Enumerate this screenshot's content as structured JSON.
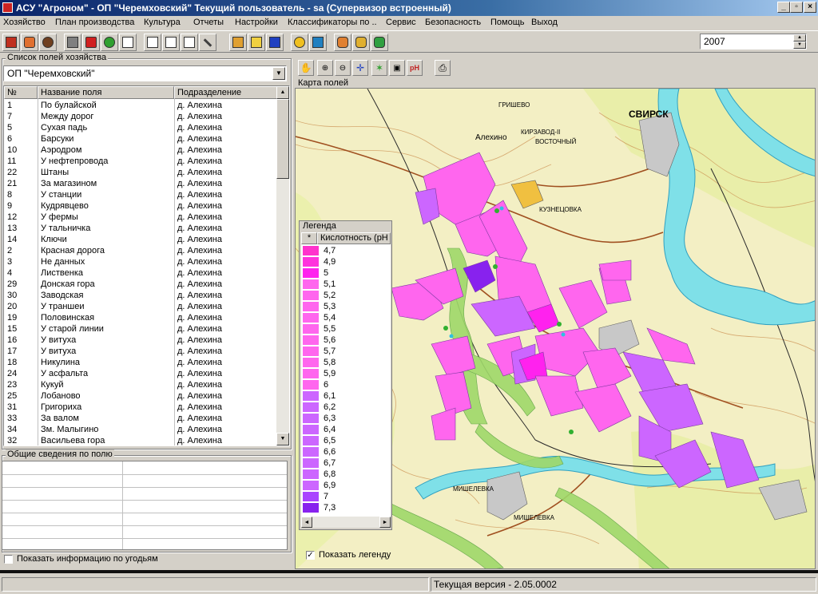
{
  "window": {
    "title": "АСУ \"Агроном\" - ОП \"Черемховский\" Текущий пользователь - sa (Супервизор встроенный)"
  },
  "menu": [
    "Хозяйство",
    "План производства",
    "Культура",
    "Отчеты",
    "Настройки",
    "Классификаторы по ..",
    "Сервис",
    "Безопасность",
    "Помощь",
    "Выход"
  ],
  "toolbar": {
    "year": "2007"
  },
  "fields_panel": {
    "title": "Список полей хозяйства",
    "farm_select": "ОП \"Черемховский\"",
    "columns": [
      "№",
      "Название поля",
      "Подразделение"
    ],
    "rows": [
      [
        "1",
        "По булайской",
        "д. Алехина"
      ],
      [
        "7",
        "Между дорог",
        "д. Алехина"
      ],
      [
        "5",
        "Сухая падь",
        "д. Алехина"
      ],
      [
        "6",
        "Барсуки",
        "д. Алехина"
      ],
      [
        "10",
        "Аэродром",
        "д. Алехина"
      ],
      [
        "11",
        "У нефтепровода",
        "д. Алехина"
      ],
      [
        "22",
        "Штаны",
        "д. Алехина"
      ],
      [
        "21",
        "За магазином",
        "д. Алехина"
      ],
      [
        "8",
        "У станции",
        "д. Алехина"
      ],
      [
        "9",
        "Кудрявцево",
        "д. Алехина"
      ],
      [
        "12",
        "У фермы",
        "д. Алехина"
      ],
      [
        "13",
        "У тальничка",
        "д. Алехина"
      ],
      [
        "14",
        "Ключи",
        "д. Алехина"
      ],
      [
        "2",
        "Красная дорога",
        "д. Алехина"
      ],
      [
        "3",
        "Не данных",
        "д. Алехина"
      ],
      [
        "4",
        "Лиственка",
        "д. Алехина"
      ],
      [
        "29",
        "Донская гора",
        "д. Алехина"
      ],
      [
        "30",
        "Заводская",
        "д. Алехина"
      ],
      [
        "20",
        "У траншеи",
        "д. Алехина"
      ],
      [
        "19",
        "Половинская",
        "д. Алехина"
      ],
      [
        "15",
        "У старой линии",
        "д. Алехина"
      ],
      [
        "16",
        "У витуха",
        "д. Алехина"
      ],
      [
        "17",
        "У витуха",
        "д. Алехина"
      ],
      [
        "18",
        "Никулина",
        "д. Алехина"
      ],
      [
        "24",
        "У асфальта",
        "д. Алехина"
      ],
      [
        "23",
        "Кукуй",
        "д. Алехина"
      ],
      [
        "25",
        "Лобаново",
        "д. Алехина"
      ],
      [
        "31",
        "Григориха",
        "д. Алехина"
      ],
      [
        "33",
        "За валом",
        "д. Алехина"
      ],
      [
        "34",
        "Зм. Малыгино",
        "д. Алехина"
      ],
      [
        "32",
        "Васильева гора",
        "д. Алехина"
      ]
    ]
  },
  "info_panel": {
    "title": "Общие сведения по полю",
    "checkbox_label": "Показать информацию по угодьям"
  },
  "map_panel": {
    "title": "Карта полей",
    "place_labels": [
      "СВИРСК",
      "Алехино",
      "ГРИШЕВО",
      "КИРЗАВОД-II",
      "ВОСТОЧНЫЙ",
      "КУЗНЕЦОВКА",
      "МИШЕЛЕВКА",
      "МИШЕЛЕВКА"
    ],
    "show_legend_label": "Показать легенду"
  },
  "legend": {
    "title": "Легенда",
    "col_marker": "*",
    "col_header": "Кислотность (pH",
    "items": [
      {
        "value": "4,7",
        "color": "#ff33cc"
      },
      {
        "value": "4,9",
        "color": "#ff33dd"
      },
      {
        "value": "5",
        "color": "#ff22ee"
      },
      {
        "value": "5,1",
        "color": "#ff66ee"
      },
      {
        "value": "5,2",
        "color": "#ff66ee"
      },
      {
        "value": "5,3",
        "color": "#ff66ee"
      },
      {
        "value": "5,4",
        "color": "#ff66ee"
      },
      {
        "value": "5,5",
        "color": "#ff66ee"
      },
      {
        "value": "5,6",
        "color": "#ff66ee"
      },
      {
        "value": "5,7",
        "color": "#ff66ee"
      },
      {
        "value": "5,8",
        "color": "#ff66ee"
      },
      {
        "value": "5,9",
        "color": "#ff66ee"
      },
      {
        "value": "6",
        "color": "#ff66ee"
      },
      {
        "value": "6,1",
        "color": "#cc66ff"
      },
      {
        "value": "6,2",
        "color": "#cc66ff"
      },
      {
        "value": "6,3",
        "color": "#cc66ff"
      },
      {
        "value": "6,4",
        "color": "#cc66ff"
      },
      {
        "value": "6,5",
        "color": "#cc66ff"
      },
      {
        "value": "6,6",
        "color": "#cc66ff"
      },
      {
        "value": "6,7",
        "color": "#cc66ff"
      },
      {
        "value": "6,8",
        "color": "#cc66ff"
      },
      {
        "value": "6,9",
        "color": "#cc66ff"
      },
      {
        "value": "7",
        "color": "#aa44ff"
      },
      {
        "value": "7,3",
        "color": "#8822ee"
      }
    ]
  },
  "status": {
    "version": "Текущая версия - 2.05.0002"
  }
}
